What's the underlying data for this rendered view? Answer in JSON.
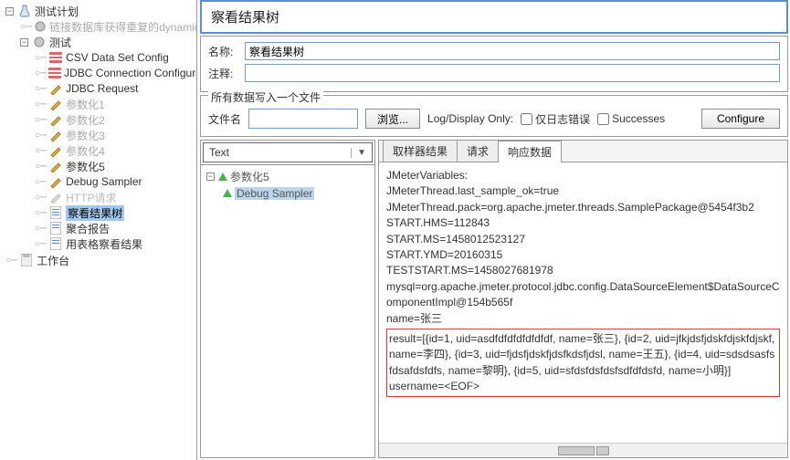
{
  "left_tree": {
    "root": "测试计划",
    "items": [
      {
        "label": "链接数据库获得重复的dynamic",
        "icon": "gear",
        "indent": 1
      },
      {
        "label": "测试",
        "icon": "gear",
        "indent": 1,
        "expandable": true
      },
      {
        "label": "CSV Data Set Config",
        "icon": "csv",
        "indent": 2
      },
      {
        "label": "JDBC Connection Configurat",
        "icon": "csv",
        "indent": 2
      },
      {
        "label": "JDBC Request",
        "icon": "pen",
        "indent": 2
      },
      {
        "label": "参数化1",
        "icon": "pen",
        "indent": 2
      },
      {
        "label": "参数化2",
        "icon": "pen",
        "indent": 2
      },
      {
        "label": "参数化3",
        "icon": "pen",
        "indent": 2
      },
      {
        "label": "参数化4",
        "icon": "pen",
        "indent": 2
      },
      {
        "label": "参数化5",
        "icon": "pen",
        "indent": 2
      },
      {
        "label": "Debug Sampler",
        "icon": "pen",
        "indent": 2
      },
      {
        "label": "HTTP请求",
        "icon": "pen",
        "indent": 2,
        "dim": true
      },
      {
        "label": "察看结果树",
        "icon": "page",
        "indent": 2,
        "active": true
      },
      {
        "label": "聚合报告",
        "icon": "page",
        "indent": 2
      },
      {
        "label": "用表格察看结果",
        "icon": "page",
        "indent": 2
      }
    ],
    "workbench": "工作台"
  },
  "panel": {
    "title": "察看结果树",
    "name_label": "名称:",
    "name_value": "察看结果树",
    "comment_label": "注释:",
    "comment_value": ""
  },
  "file_group": {
    "legend": "所有数据写入一个文件",
    "filename_label": "文件名",
    "filename_value": "",
    "browse": "浏览...",
    "logdisplay": "Log/Display Only:",
    "chk_errors": "仅日志错误",
    "chk_success": "Successes",
    "configure": "Configure"
  },
  "mid_left": {
    "dropdown": "Text",
    "tree": [
      {
        "label": "参数化5"
      },
      {
        "label": "Debug Sampler",
        "selected": true
      }
    ]
  },
  "tabs": {
    "t1": "取样器结果",
    "t2": "请求",
    "t3": "响应数据"
  },
  "response": {
    "lines_top": [
      "JMeterVariables:",
      "JMeterThread.last_sample_ok=true",
      "JMeterThread.pack=org.apache.jmeter.threads.SamplePackage@5454f3b2",
      "START.HMS=112843",
      "START.MS=1458012523127",
      "START.YMD=20160315",
      "TESTSTART.MS=1458027681978",
      "mysql=org.apache.jmeter.protocol.jdbc.config.DataSourceElement$DataSourceComponentImpl@154b565f",
      "name=张三"
    ],
    "lines_boxed": [
      "result=[{id=1, uid=asdfdfdfdfdfdfdf, name=张三}, {id=2, uid=jfkjdsfjdskfdjskfdjskf, name=李四}, {id=3, uid=fjdsfjdskfjdsfkdsfjdsl, name=王五}, {id=4, uid=sdsdsasfsfdsafdsfdfs, name=黎明}, {id=5, uid=sfdsfdsfdsfsdfdfdsfd, name=小明}]",
      "username=<EOF>"
    ]
  }
}
